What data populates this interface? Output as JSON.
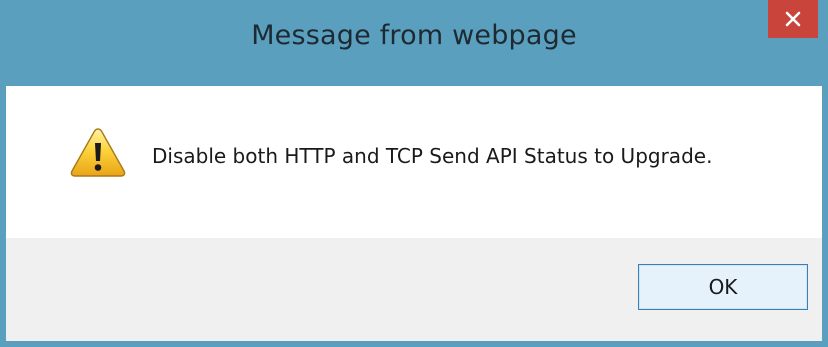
{
  "window": {
    "title": "Message from webpage",
    "close_icon": "close-x-icon",
    "title_bar_color": "#5aa0be",
    "close_button_color": "#c9453c"
  },
  "content": {
    "icon": "warning-icon",
    "message": "Disable both HTTP and TCP Send API Status to Upgrade."
  },
  "footer": {
    "ok_label": "OK"
  }
}
